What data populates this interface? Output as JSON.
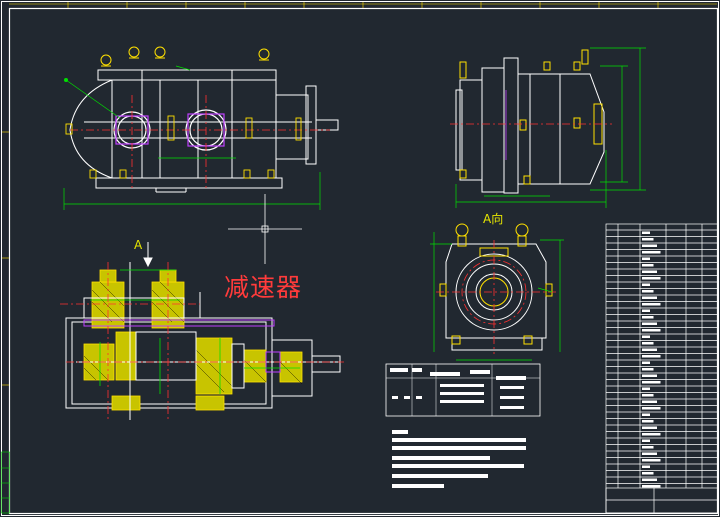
{
  "drawing": {
    "title_cn": "减速器",
    "section_label": "A",
    "view_label": "A向"
  },
  "colors": {
    "background": "#212830",
    "border": "#ffffff",
    "outline": "#ffffff",
    "centerline": "#ff3030",
    "dimension": "#00e000",
    "hatch": "#e6e600",
    "purple": "#c040ff",
    "text_red": "#ff3b3b"
  }
}
